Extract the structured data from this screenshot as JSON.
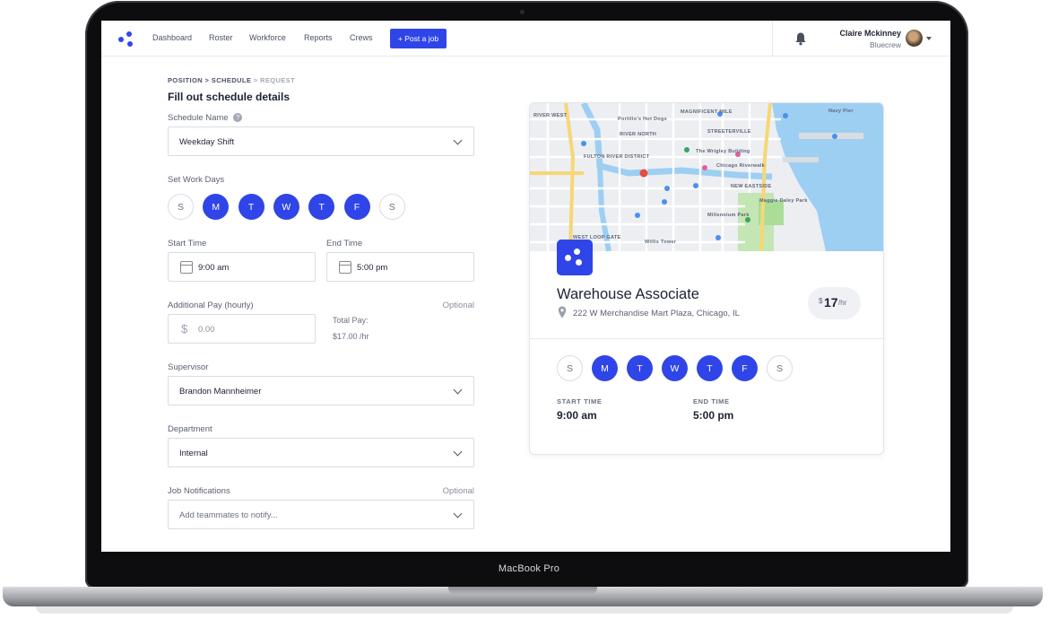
{
  "device": {
    "bezel_label": "MacBook Pro"
  },
  "nav": {
    "links": [
      "Dashboard",
      "Roster",
      "Workforce",
      "Reports",
      "Crews"
    ],
    "post_job_label": "+ Post a job",
    "user_name": "Claire Mckinney",
    "user_org": "Bluecrew"
  },
  "breadcrumb": {
    "step1": "POSITION",
    "sep": ">",
    "step2": "SCHEDULE",
    "step3": "REQUEST"
  },
  "form": {
    "title": "Fill out schedule details",
    "schedule_name_label": "Schedule Name",
    "schedule_name_value": "Weekday Shift",
    "work_days_label": "Set Work Days",
    "days": [
      {
        "letter": "S",
        "on": false
      },
      {
        "letter": "M",
        "on": true
      },
      {
        "letter": "T",
        "on": true
      },
      {
        "letter": "W",
        "on": true
      },
      {
        "letter": "T",
        "on": true
      },
      {
        "letter": "F",
        "on": true
      },
      {
        "letter": "S",
        "on": false
      }
    ],
    "start_time_label": "Start Time",
    "start_time_value": "9:00 am",
    "end_time_label": "End Time",
    "end_time_value": "5:00 pm",
    "additional_pay_label": "Additional Pay (hourly)",
    "optional_label": "Optional",
    "currency_symbol": "$",
    "additional_pay_placeholder": "0.00",
    "total_pay_label": "Total Pay:",
    "total_pay_value": "$17.00 /hr",
    "supervisor_label": "Supervisor",
    "supervisor_value": "Brandon Mannheimer",
    "department_label": "Department",
    "department_value": "Internal",
    "notifications_label": "Job Notifications",
    "notifications_placeholder": "Add teammates to notify..."
  },
  "card": {
    "title": "Warehouse Associate",
    "address": "222 W Merchandise Mart Plaza, Chicago, IL",
    "rate_currency": "$",
    "rate_amount": "17",
    "rate_unit": "/hr",
    "start_time_label": "START TIME",
    "start_time_value": "9:00 am",
    "end_time_label": "END TIME",
    "end_time_value": "5:00 pm",
    "map_labels": [
      "RIVER WEST",
      "MAGNIFICENT MILE",
      "STREETERVILLE",
      "RIVER NORTH",
      "FULTON RIVER DISTRICT",
      "NEW EASTSIDE",
      "WEST LOOP GATE",
      "Portillo's Hot Dogs",
      "The Wrigley Building",
      "Chicago Riverwalk",
      "Millennium Park",
      "Willis Tower",
      "Navy Pier",
      "Maggie Daley Park"
    ]
  }
}
